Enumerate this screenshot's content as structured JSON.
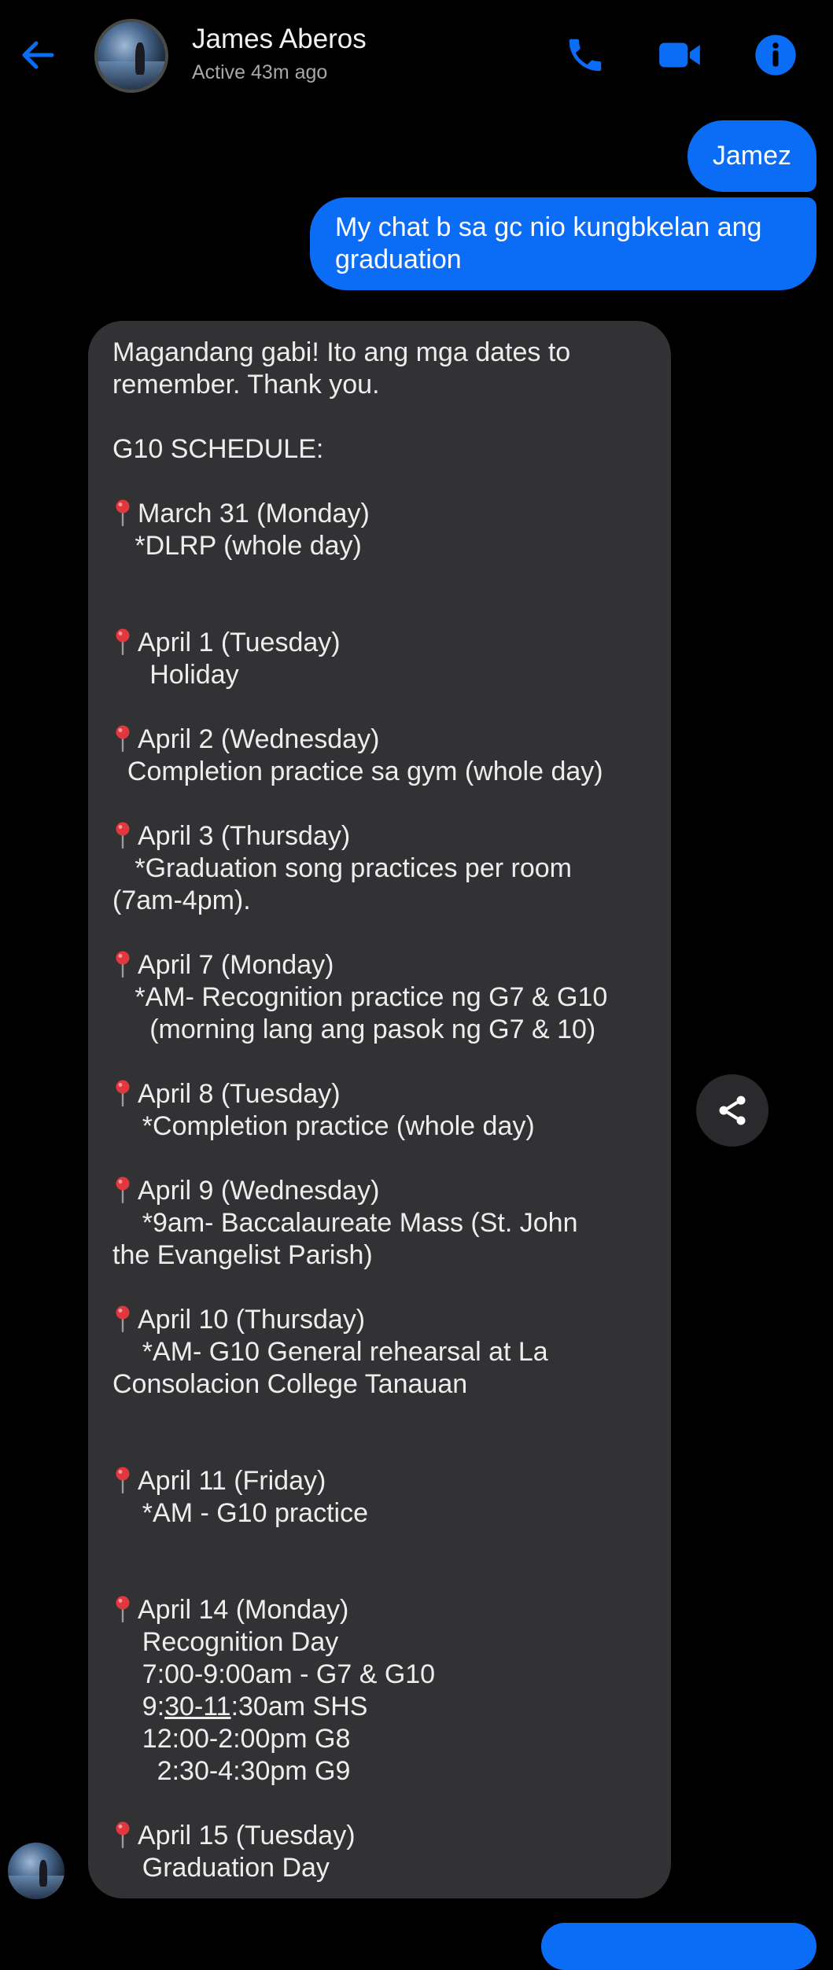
{
  "header": {
    "contact_name": "James Aberos",
    "status": "Active 43m ago",
    "icons": {
      "back": "back-arrow-icon",
      "phone": "phone-icon",
      "video": "video-camera-icon",
      "info": "info-icon"
    }
  },
  "colors": {
    "accent": "#0b6cf5",
    "background": "#000000",
    "incoming_bubble": "#323234",
    "pin": "#e0383e"
  },
  "messages": [
    {
      "direction": "outgoing",
      "text": "Jamez"
    },
    {
      "direction": "outgoing",
      "lines": [
        "My chat b sa gc nio kungbkelan ang",
        "graduation"
      ]
    },
    {
      "direction": "incoming",
      "lines": [
        {
          "pin": false,
          "text": "Magandang gabi! Ito ang mga dates to"
        },
        {
          "pin": false,
          "text": "remember. Thank you."
        },
        {
          "pin": false,
          "text": ""
        },
        {
          "pin": false,
          "text": "G10 SCHEDULE:"
        },
        {
          "pin": false,
          "text": ""
        },
        {
          "pin": true,
          "text": "March 31 (Monday)"
        },
        {
          "pin": false,
          "text": "   *DLRP (whole day)"
        },
        {
          "pin": false,
          "text": ""
        },
        {
          "pin": false,
          "text": ""
        },
        {
          "pin": true,
          "text": "April 1 (Tuesday)"
        },
        {
          "pin": false,
          "text": "     Holiday"
        },
        {
          "pin": false,
          "text": ""
        },
        {
          "pin": true,
          "text": "April 2 (Wednesday)"
        },
        {
          "pin": false,
          "text": "  Completion practice sa gym (whole day)"
        },
        {
          "pin": false,
          "text": ""
        },
        {
          "pin": true,
          "text": "April 3 (Thursday)"
        },
        {
          "pin": false,
          "text": "   *Graduation song practices per room"
        },
        {
          "pin": false,
          "text": "(7am-4pm)."
        },
        {
          "pin": false,
          "text": ""
        },
        {
          "pin": true,
          "text": "April 7 (Monday)"
        },
        {
          "pin": false,
          "text": "   *AM- Recognition practice ng G7 & G10"
        },
        {
          "pin": false,
          "text": "     (morning lang ang pasok ng G7 & 10)"
        },
        {
          "pin": false,
          "text": ""
        },
        {
          "pin": true,
          "text": "April 8 (Tuesday)"
        },
        {
          "pin": false,
          "text": "    *Completion practice (whole day)"
        },
        {
          "pin": false,
          "text": ""
        },
        {
          "pin": true,
          "text": "April 9 (Wednesday)"
        },
        {
          "pin": false,
          "text": "    *9am- Baccalaureate Mass (St. John"
        },
        {
          "pin": false,
          "text": "the Evangelist Parish)"
        },
        {
          "pin": false,
          "text": ""
        },
        {
          "pin": true,
          "text": "April 10 (Thursday)"
        },
        {
          "pin": false,
          "text": "    *AM- G10 General rehearsal at La"
        },
        {
          "pin": false,
          "text": "Consolacion College Tanauan"
        },
        {
          "pin": false,
          "text": ""
        },
        {
          "pin": false,
          "text": ""
        },
        {
          "pin": true,
          "text": "April 11 (Friday)"
        },
        {
          "pin": false,
          "text": "    *AM - G10 practice"
        },
        {
          "pin": false,
          "text": ""
        },
        {
          "pin": false,
          "text": ""
        },
        {
          "pin": true,
          "text": "April 14 (Monday)"
        },
        {
          "pin": false,
          "text": "    Recognition Day"
        },
        {
          "pin": false,
          "text": "    7:00-9:00am - G7 & G10"
        },
        {
          "pin": false,
          "text": "    9:",
          "underline": "30-11",
          "after": ":30am SHS"
        },
        {
          "pin": false,
          "text": "    12:00-2:00pm G8"
        },
        {
          "pin": false,
          "text": "      2:30-4:30pm G9"
        },
        {
          "pin": false,
          "text": ""
        },
        {
          "pin": true,
          "text": "April 15 (Tuesday)"
        },
        {
          "pin": false,
          "text": "    Graduation Day"
        }
      ]
    }
  ],
  "actions": {
    "share_icon": "share-icon",
    "pin_icon": "pin-icon"
  }
}
